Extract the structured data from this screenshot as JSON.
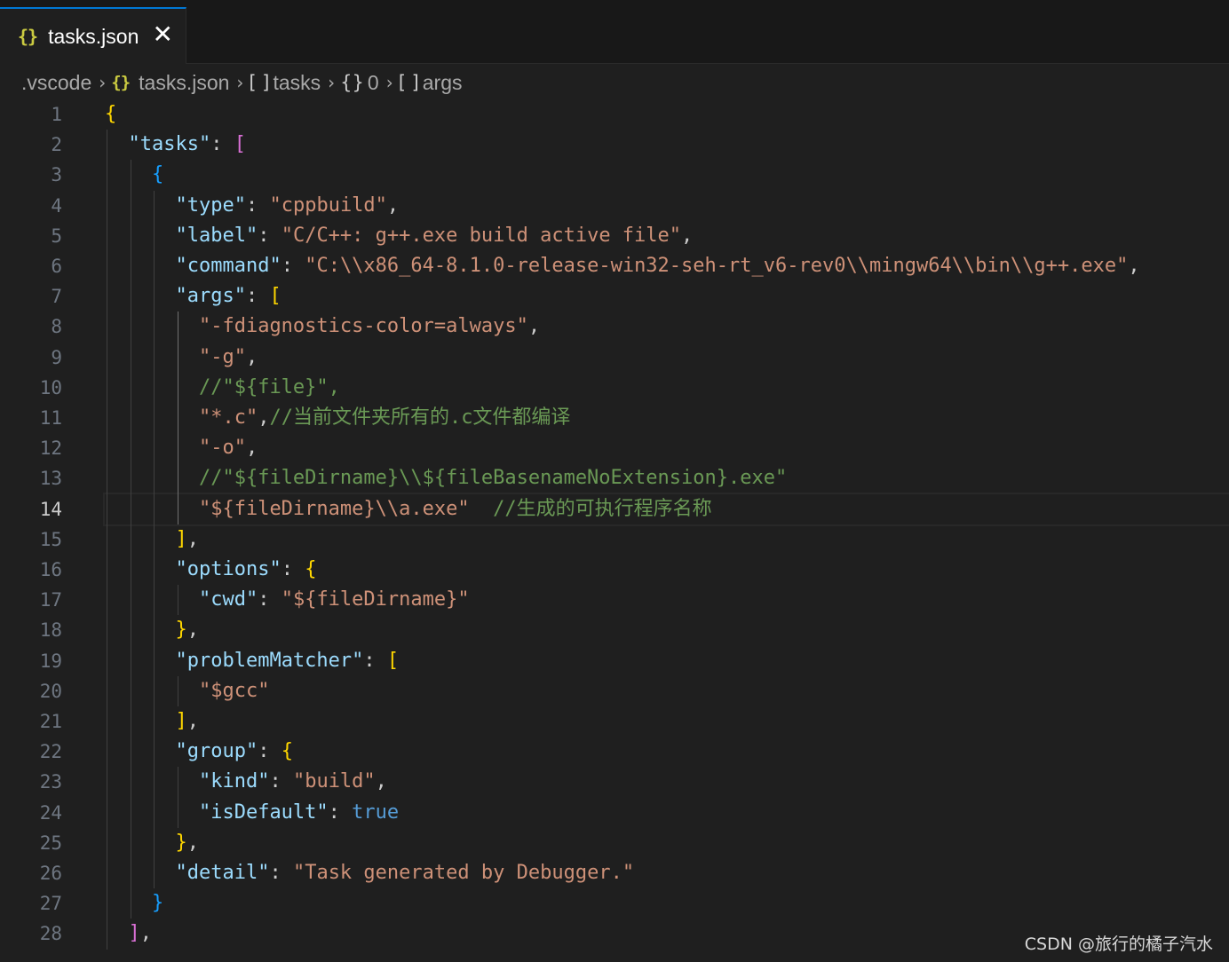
{
  "tab": {
    "icon": "json-icon",
    "label": "tasks.json",
    "close_glyph": "✕"
  },
  "breadcrumb": {
    "folder": ".vscode",
    "file": "tasks.json",
    "tasks": "tasks",
    "index": "0",
    "args": "args"
  },
  "editor": {
    "current_line": 14,
    "lines": [
      [
        [
          "b1",
          "{"
        ]
      ],
      [
        [
          "p",
          "  "
        ],
        [
          "k",
          "\"tasks\""
        ],
        [
          "p",
          ": "
        ],
        [
          "b2",
          "["
        ]
      ],
      [
        [
          "p",
          "    "
        ],
        [
          "b3",
          "{"
        ]
      ],
      [
        [
          "p",
          "      "
        ],
        [
          "k",
          "\"type\""
        ],
        [
          "p",
          ": "
        ],
        [
          "s",
          "\"cppbuild\""
        ],
        [
          "p",
          ","
        ]
      ],
      [
        [
          "p",
          "      "
        ],
        [
          "k",
          "\"label\""
        ],
        [
          "p",
          ": "
        ],
        [
          "s",
          "\"C/C++: g++.exe build active file\""
        ],
        [
          "p",
          ","
        ]
      ],
      [
        [
          "p",
          "      "
        ],
        [
          "k",
          "\"command\""
        ],
        [
          "p",
          ": "
        ],
        [
          "s",
          "\"C:\\\\x86_64-8.1.0-release-win32-seh-rt_v6-rev0\\\\mingw64\\\\bin\\\\g++.exe\""
        ],
        [
          "p",
          ","
        ]
      ],
      [
        [
          "p",
          "      "
        ],
        [
          "k",
          "\"args\""
        ],
        [
          "p",
          ": "
        ],
        [
          "b1",
          "["
        ]
      ],
      [
        [
          "p",
          "        "
        ],
        [
          "s",
          "\"-fdiagnostics-color=always\""
        ],
        [
          "p",
          ","
        ]
      ],
      [
        [
          "p",
          "        "
        ],
        [
          "s",
          "\"-g\""
        ],
        [
          "p",
          ","
        ]
      ],
      [
        [
          "p",
          "        "
        ],
        [
          "c",
          "//\"${file}\","
        ]
      ],
      [
        [
          "p",
          "        "
        ],
        [
          "s",
          "\"*.c\""
        ],
        [
          "p",
          ","
        ],
        [
          "c",
          "//当前文件夹所有的.c文件都编译"
        ]
      ],
      [
        [
          "p",
          "        "
        ],
        [
          "s",
          "\"-o\""
        ],
        [
          "p",
          ","
        ]
      ],
      [
        [
          "p",
          "        "
        ],
        [
          "c",
          "//\"${fileDirname}\\\\${fileBasenameNoExtension}.exe\""
        ]
      ],
      [
        [
          "p",
          "        "
        ],
        [
          "s",
          "\"${fileDirname}\\\\a.exe\""
        ],
        [
          "p",
          "  "
        ],
        [
          "c",
          "//生成的可执行程序名称"
        ]
      ],
      [
        [
          "p",
          "      "
        ],
        [
          "b1",
          "]"
        ],
        [
          "p",
          ","
        ]
      ],
      [
        [
          "p",
          "      "
        ],
        [
          "k",
          "\"options\""
        ],
        [
          "p",
          ": "
        ],
        [
          "b1",
          "{"
        ]
      ],
      [
        [
          "p",
          "        "
        ],
        [
          "k",
          "\"cwd\""
        ],
        [
          "p",
          ": "
        ],
        [
          "s",
          "\"${fileDirname}\""
        ]
      ],
      [
        [
          "p",
          "      "
        ],
        [
          "b1",
          "}"
        ],
        [
          "p",
          ","
        ]
      ],
      [
        [
          "p",
          "      "
        ],
        [
          "k",
          "\"problemMatcher\""
        ],
        [
          "p",
          ": "
        ],
        [
          "b1",
          "["
        ]
      ],
      [
        [
          "p",
          "        "
        ],
        [
          "s",
          "\"$gcc\""
        ]
      ],
      [
        [
          "p",
          "      "
        ],
        [
          "b1",
          "]"
        ],
        [
          "p",
          ","
        ]
      ],
      [
        [
          "p",
          "      "
        ],
        [
          "k",
          "\"group\""
        ],
        [
          "p",
          ": "
        ],
        [
          "b1",
          "{"
        ]
      ],
      [
        [
          "p",
          "        "
        ],
        [
          "k",
          "\"kind\""
        ],
        [
          "p",
          ": "
        ],
        [
          "s",
          "\"build\""
        ],
        [
          "p",
          ","
        ]
      ],
      [
        [
          "p",
          "        "
        ],
        [
          "k",
          "\"isDefault\""
        ],
        [
          "p",
          ": "
        ],
        [
          "kw",
          "true"
        ]
      ],
      [
        [
          "p",
          "      "
        ],
        [
          "b1",
          "}"
        ],
        [
          "p",
          ","
        ]
      ],
      [
        [
          "p",
          "      "
        ],
        [
          "k",
          "\"detail\""
        ],
        [
          "p",
          ": "
        ],
        [
          "s",
          "\"Task generated by Debugger.\""
        ]
      ],
      [
        [
          "p",
          "    "
        ],
        [
          "b3",
          "}"
        ]
      ],
      [
        [
          "p",
          "  "
        ],
        [
          "b2",
          "]"
        ],
        [
          "p",
          ","
        ]
      ]
    ]
  },
  "watermark": "CSDN @旅行的橘子汽水"
}
